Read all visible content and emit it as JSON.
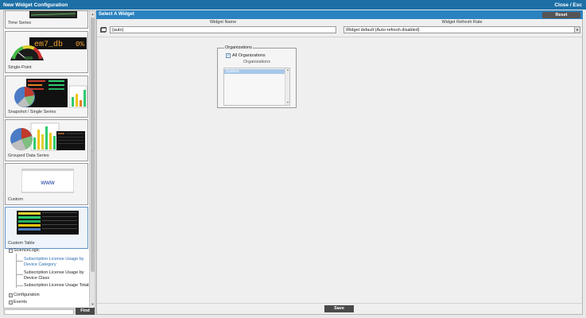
{
  "window": {
    "title": "New Widget Configuration",
    "close_label": "Close / Esc"
  },
  "widget_types": [
    {
      "label": "Time Series",
      "icon": "time-series-thumbnail"
    },
    {
      "label": "Single-Point",
      "icon": "single-point-thumbnail",
      "display_text": "em7_db",
      "display_value": "0%"
    },
    {
      "label": "Snapshot / Single Series",
      "icon": "snapshot-thumbnail"
    },
    {
      "label": "Grouped Data Series",
      "icon": "grouped-series-thumbnail"
    },
    {
      "label": "Custom",
      "icon": "custom-thumbnail",
      "display_text": "www"
    },
    {
      "label": "Custom Table",
      "icon": "custom-table-thumbnail"
    }
  ],
  "tree": {
    "root": "ScienceLogic",
    "children": [
      "Subscription License Usage by Device Category",
      "Subscription License Usage by Device Class",
      "Subscription License Usage Totals"
    ],
    "others": [
      "Configuration",
      "Events"
    ]
  },
  "find": {
    "button_label": "Find",
    "value": ""
  },
  "main": {
    "header_title": "Select A Widget",
    "reset_label": "Reset",
    "widget_name_header": "Widget Name",
    "widget_name_value": "{auto}",
    "refresh_header": "Widget Refresh Rate",
    "refresh_value": "Widget default (Auto-refresh disabled)",
    "organizations": {
      "legend": "Organizations",
      "all_label": "All Organizations",
      "all_checked": true,
      "list_header": "Organizations",
      "items": [
        "System"
      ]
    },
    "save_label": "Save"
  },
  "colors": {
    "titlebar": "#1d6fa5",
    "header": "#2b82c0",
    "button": "#4a4a4a"
  }
}
